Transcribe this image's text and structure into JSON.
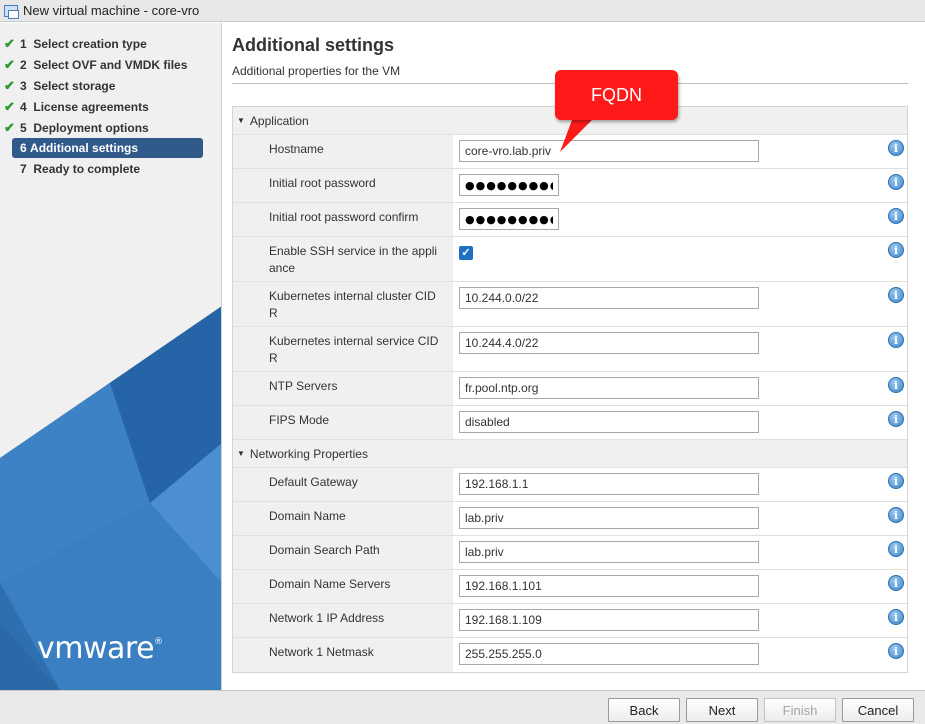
{
  "window": {
    "title": "New virtual machine - core-vro"
  },
  "wizard": {
    "steps": [
      {
        "number": "1",
        "label": "Select creation type",
        "done": true
      },
      {
        "number": "2",
        "label": "Select OVF and VMDK files",
        "done": true
      },
      {
        "number": "3",
        "label": "Select storage",
        "done": true
      },
      {
        "number": "4",
        "label": "License agreements",
        "done": true
      },
      {
        "number": "5",
        "label": "Deployment options",
        "done": true
      },
      {
        "number": "6",
        "label": "Additional settings",
        "active": true
      },
      {
        "number": "7",
        "label": "Ready to complete"
      }
    ],
    "logo": "vmware",
    "logo_mark": "®"
  },
  "page": {
    "title": "Additional settings",
    "subtitle": "Additional properties for the VM"
  },
  "callout": {
    "text": "FQDN",
    "color": "#ff1a1a"
  },
  "sections": {
    "application": {
      "title": "Application",
      "hostname": {
        "label": "Hostname",
        "value": "core-vro.lab.priv"
      },
      "root_password": {
        "label": "Initial root password",
        "value": "●●●●●●●●●●●"
      },
      "root_password_confirm": {
        "label": "Initial root password confirm",
        "value": "●●●●●●●●●●●"
      },
      "ssh": {
        "label": "Enable SSH service in the appli ance",
        "checked": true
      },
      "k8s_cluster_cidr": {
        "label": "Kubernetes internal cluster CID R",
        "value": "10.244.0.0/22"
      },
      "k8s_service_cidr": {
        "label": "Kubernetes internal service CID R",
        "value": "10.244.4.0/22"
      },
      "ntp": {
        "label": "NTP Servers",
        "value": "fr.pool.ntp.org"
      },
      "fips": {
        "label": "FIPS Mode",
        "value": "disabled"
      }
    },
    "networking": {
      "title": "Networking Properties",
      "gateway": {
        "label": "Default Gateway",
        "value": "192.168.1.1"
      },
      "domain_name": {
        "label": "Domain Name",
        "value": "lab.priv"
      },
      "search_path": {
        "label": "Domain Search Path",
        "value": "lab.priv"
      },
      "dns": {
        "label": "Domain Name Servers",
        "value": "192.168.1.101"
      },
      "ip": {
        "label": "Network 1 IP Address",
        "value": "192.168.1.109"
      },
      "netmask": {
        "label": "Network 1 Netmask",
        "value": "255.255.255.0"
      }
    }
  },
  "info_glyph": "i",
  "footer": {
    "back": "Back",
    "next": "Next",
    "finish": "Finish",
    "cancel": "Cancel"
  },
  "colors": {
    "active_step": "#2f5a8a",
    "check": "#2e9a2e",
    "info": "#3b86cc"
  }
}
